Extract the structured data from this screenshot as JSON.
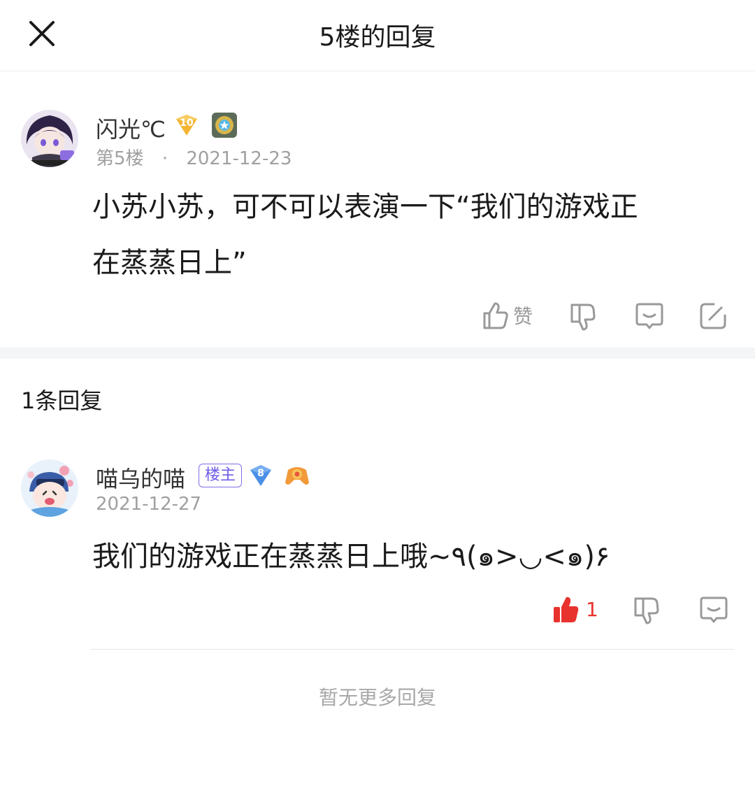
{
  "header": {
    "title": "5楼的回复",
    "close_icon": "close-icon"
  },
  "post": {
    "username": "闪光℃",
    "level_badge": "10",
    "floor": "第5楼",
    "separator": "·",
    "date": "2021-12-23",
    "content_line1": "小苏小苏，可不可以表演一下“我们的游戏正",
    "content_line2": "在蒸蒸日上”",
    "actions": {
      "like_label": "赞",
      "like_icon": "thumb-up-icon",
      "dislike_icon": "thumb-down-icon",
      "comment_icon": "comment-icon",
      "edit_icon": "edit-icon"
    }
  },
  "replies_section": {
    "count_label": "1条回复"
  },
  "reply": {
    "username": "喵乌的喵",
    "owner_badge": "楼主",
    "level_badge": "8",
    "date": "2021-12-27",
    "content": "我们的游戏正在蒸蒸日上哦~٩(๑>◡<๑)۶",
    "like_count": "1",
    "colors": {
      "liked": "#e8322d",
      "owner_badge": "#6c5ce7"
    }
  },
  "footer": {
    "no_more": "暂无更多回复"
  }
}
